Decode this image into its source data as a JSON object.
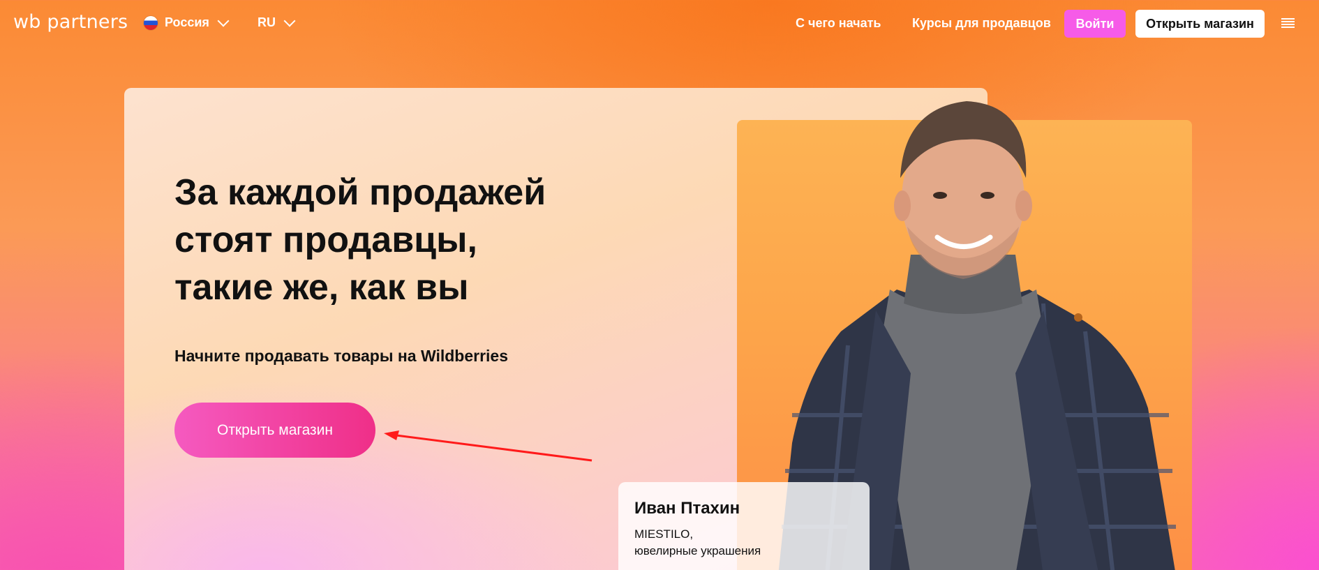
{
  "header": {
    "logo_text": "wb partners",
    "country_label": "Россия",
    "language_label": "RU",
    "nav": {
      "start_label": "С чего начать",
      "courses_label": "Курсы для продавцов"
    },
    "login_label": "Войти",
    "open_store_label": "Открыть магазин"
  },
  "hero": {
    "title_lines": [
      "За каждой продажей",
      "стоят продавцы,",
      "такие же, как вы"
    ],
    "subtitle": "Начните продавать товары на Wildberries",
    "cta_label": "Открыть магазин"
  },
  "testimonial": {
    "name": "Иван Птахин",
    "company": "MIESTILO,",
    "category": "ювелирные украшения"
  },
  "icons": {
    "flag": "russia-flag-icon",
    "dropdown": "chevron-down-icon",
    "menu": "hamburger-menu-icon",
    "annotation": "red-arrow-annotation"
  },
  "colors": {
    "accent_pink": "#f65be8",
    "cta_gradient_start": "#f55ac0",
    "cta_gradient_end": "#ef2f88",
    "annotation_arrow": "#ff1a1a"
  }
}
